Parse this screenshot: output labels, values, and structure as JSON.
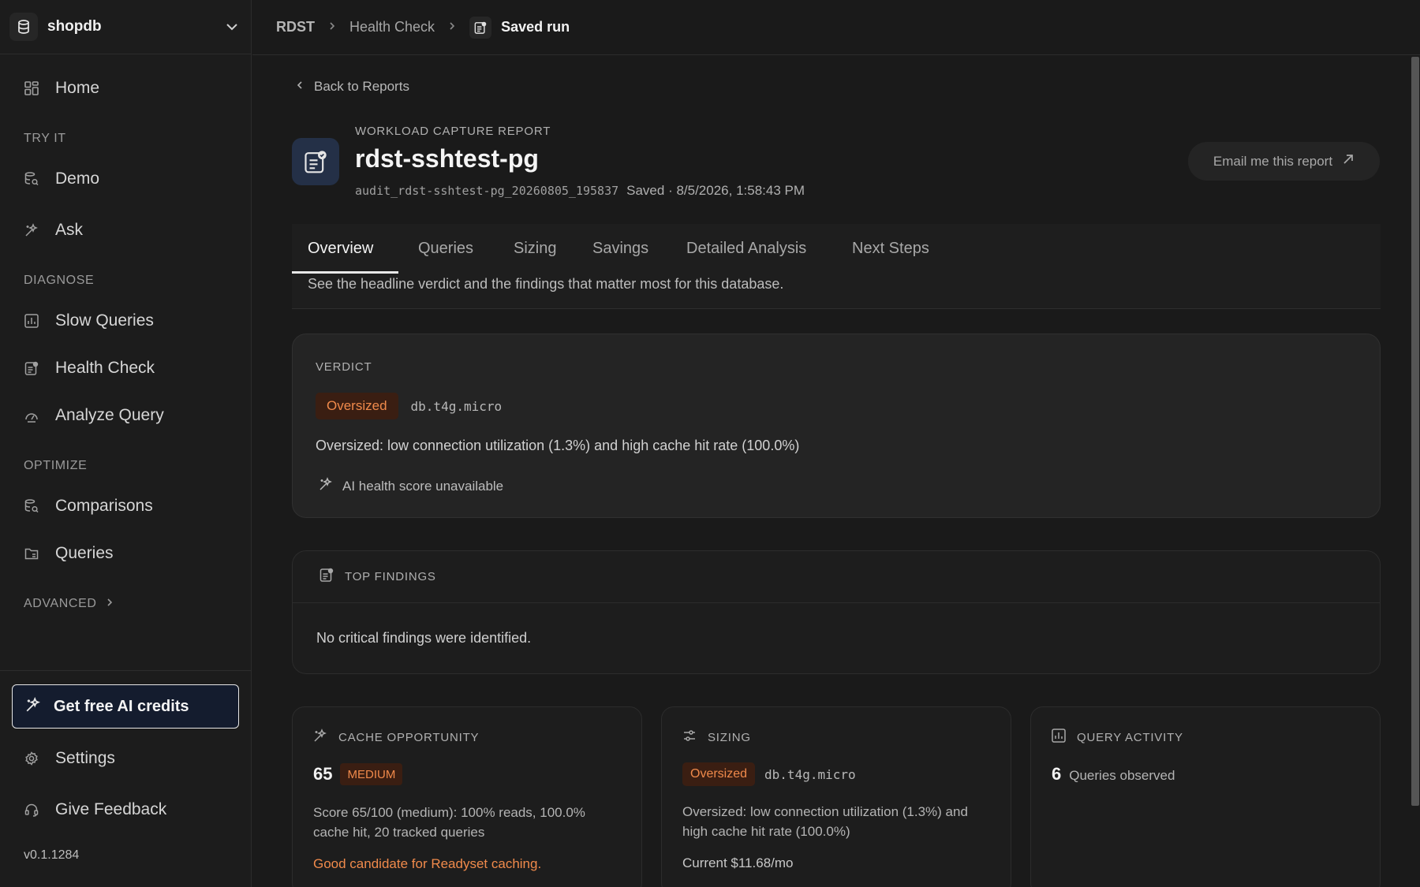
{
  "sidebar": {
    "db_name": "shopdb",
    "home_label": "Home",
    "sections": {
      "try_it": "TRY IT",
      "diagnose": "DIAGNOSE",
      "optimize": "OPTIMIZE",
      "advanced": "ADVANCED"
    },
    "items": {
      "demo": "Demo",
      "ask": "Ask",
      "slow_queries": "Slow Queries",
      "health_check": "Health Check",
      "analyze_query": "Analyze Query",
      "comparisons": "Comparisons",
      "queries": "Queries"
    },
    "credits_label": "Get free AI credits",
    "settings_label": "Settings",
    "feedback_label": "Give Feedback",
    "version": "v0.1.1284"
  },
  "breadcrumb": {
    "root": "RDST",
    "parent": "Health Check",
    "current": "Saved run"
  },
  "report": {
    "back_label": "Back to Reports",
    "overline": "WORKLOAD CAPTURE REPORT",
    "title": "rdst-sshtest-pg",
    "id": "audit_rdst-sshtest-pg_20260805_195837",
    "saved": "Saved · 8/5/2026, 1:58:43 PM",
    "email_label": "Email me this report"
  },
  "tabs": {
    "items": [
      "Overview",
      "Queries",
      "Sizing",
      "Savings",
      "Detailed Analysis",
      "Next Steps"
    ],
    "active": "Overview",
    "description": "See the headline verdict and the findings that matter most for this database."
  },
  "verdict": {
    "label": "VERDICT",
    "badge": "Oversized",
    "instance": "db.t4g.micro",
    "summary": "Oversized: low connection utilization (1.3%) and high cache hit rate (100.0%)",
    "ai_note": "AI health score unavailable"
  },
  "findings": {
    "label": "TOP FINDINGS",
    "empty": "No critical findings were identified."
  },
  "cache": {
    "label": "CACHE OPPORTUNITY",
    "score": "65",
    "level": "MEDIUM",
    "detail": "Score 65/100 (medium): 100% reads, 100.0% cache hit, 20 tracked queries",
    "note": "Good candidate for Readyset caching."
  },
  "sizing": {
    "label": "SIZING",
    "badge": "Oversized",
    "instance": "db.t4g.micro",
    "detail": "Oversized: low connection utilization (1.3%) and high cache hit rate (100.0%)",
    "current": "Current $11.68/mo"
  },
  "activity": {
    "label": "QUERY ACTIVITY",
    "count": "6",
    "count_label": "Queries observed"
  },
  "colors": {
    "accent_orange": "#f08a4b",
    "badge_bg": "#3a1e12",
    "credits_bg": "#141c2e"
  }
}
